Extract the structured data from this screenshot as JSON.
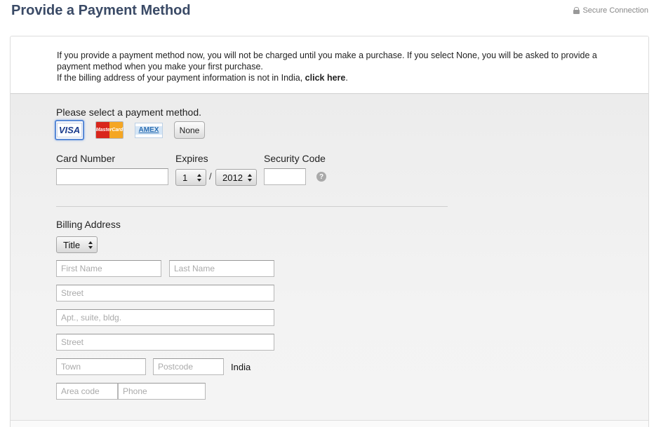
{
  "header": {
    "title": "Provide a Payment Method",
    "secure_label": "Secure Connection"
  },
  "info": {
    "line1": "If you provide a payment method now, you will not be charged until you make a purchase. If you select None, you will be asked to provide a payment method when you make your first purchase.",
    "line2_prefix": "If the billing address of your payment information is not in India, ",
    "line2_link": "click here",
    "line2_suffix": "."
  },
  "payment": {
    "select_label": "Please select a payment method.",
    "methods": [
      {
        "id": "visa",
        "label": "VISA",
        "selected": true
      },
      {
        "id": "mastercard",
        "label": "MasterCard",
        "selected": false
      },
      {
        "id": "amex",
        "label": "AMEX",
        "selected": false
      }
    ],
    "none_label": "None"
  },
  "card": {
    "number_label": "Card Number",
    "number_value": "",
    "expires_label": "Expires",
    "expires_month": "1",
    "expires_separator": "/",
    "expires_year": "2012",
    "security_label": "Security Code",
    "security_value": "",
    "help_icon": "question-mark-icon"
  },
  "billing": {
    "label": "Billing Address",
    "title_select": "Title",
    "first_name_placeholder": "First Name",
    "last_name_placeholder": "Last Name",
    "street1_placeholder": "Street",
    "apt_placeholder": "Apt., suite, bldg.",
    "street2_placeholder": "Street",
    "town_placeholder": "Town",
    "postcode_placeholder": "Postcode",
    "country": "India",
    "area_code_placeholder": "Area code",
    "phone_placeholder": "Phone"
  },
  "colors": {
    "title": "#3a4a66",
    "selected_border": "#5a8ad6",
    "help_icon": "#a9a9a9"
  }
}
